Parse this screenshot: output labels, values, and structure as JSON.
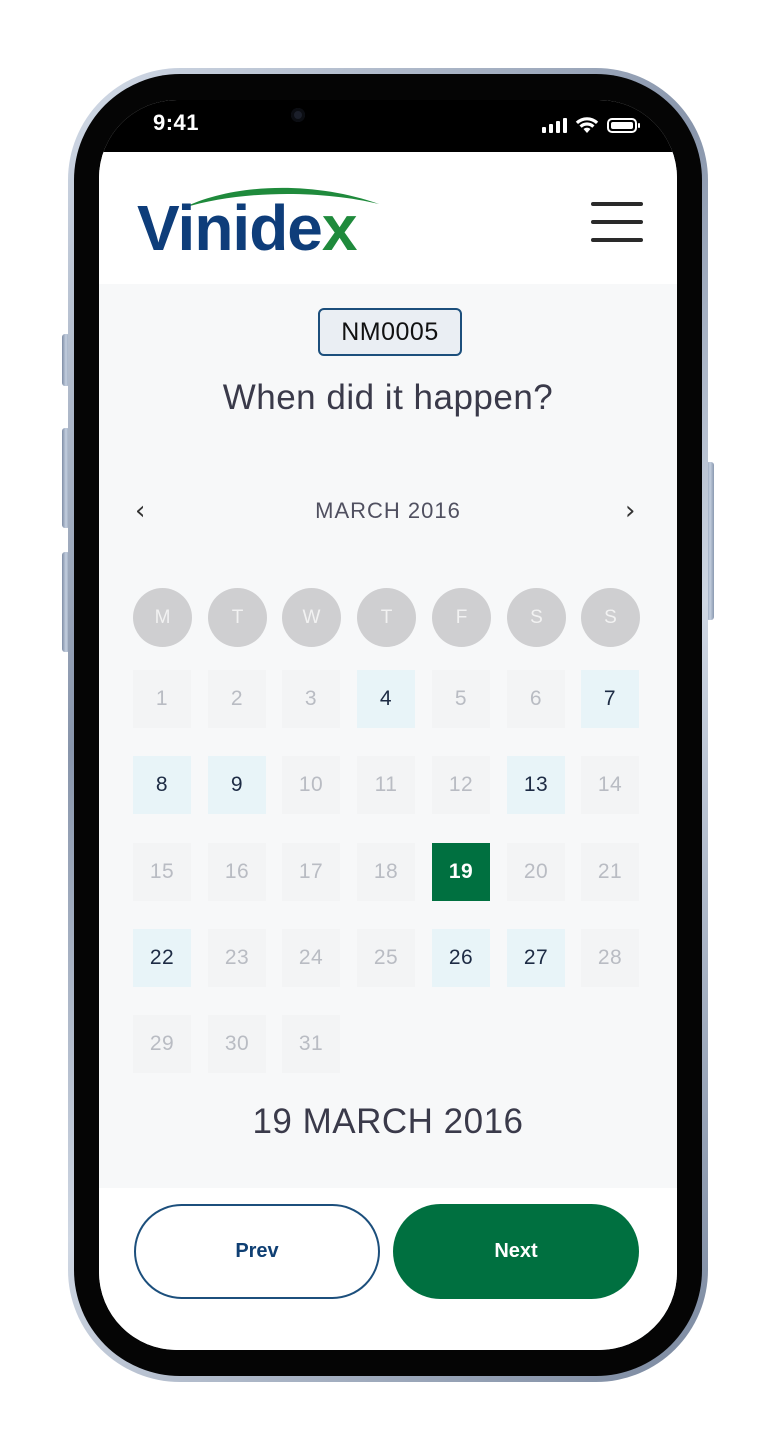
{
  "status_bar": {
    "time": "9:41",
    "icons": [
      "signal-icon",
      "wifi-icon",
      "battery-icon"
    ]
  },
  "header": {
    "logo_text_main": "Vinid",
    "logo_text_e": "e",
    "logo_text_x": "x",
    "brand_colors": {
      "blue": "#0e3d7a",
      "green": "#1f8a3c"
    },
    "menu_icon": "hamburger-icon"
  },
  "page": {
    "reference": "NM0005",
    "question": "When did it happen?"
  },
  "calendar": {
    "prev_arrow": "‹",
    "next_arrow": "›",
    "month": "MARCH 2016",
    "weekdays": [
      "M",
      "T",
      "W",
      "T",
      "F",
      "S",
      "S"
    ],
    "days": [
      {
        "label": "1",
        "state": "disabled"
      },
      {
        "label": "2",
        "state": "disabled"
      },
      {
        "label": "3",
        "state": "disabled"
      },
      {
        "label": "4",
        "state": "available"
      },
      {
        "label": "5",
        "state": "disabled"
      },
      {
        "label": "6",
        "state": "disabled"
      },
      {
        "label": "7",
        "state": "available"
      },
      {
        "label": "8",
        "state": "available"
      },
      {
        "label": "9",
        "state": "available"
      },
      {
        "label": "10",
        "state": "disabled"
      },
      {
        "label": "11",
        "state": "disabled"
      },
      {
        "label": "12",
        "state": "disabled"
      },
      {
        "label": "13",
        "state": "available"
      },
      {
        "label": "14",
        "state": "disabled"
      },
      {
        "label": "15",
        "state": "disabled"
      },
      {
        "label": "16",
        "state": "disabled"
      },
      {
        "label": "17",
        "state": "disabled"
      },
      {
        "label": "18",
        "state": "disabled"
      },
      {
        "label": "19",
        "state": "selected"
      },
      {
        "label": "20",
        "state": "disabled"
      },
      {
        "label": "21",
        "state": "disabled"
      },
      {
        "label": "22",
        "state": "available"
      },
      {
        "label": "23",
        "state": "disabled"
      },
      {
        "label": "24",
        "state": "disabled"
      },
      {
        "label": "25",
        "state": "disabled"
      },
      {
        "label": "26",
        "state": "available"
      },
      {
        "label": "27",
        "state": "available"
      },
      {
        "label": "28",
        "state": "disabled"
      },
      {
        "label": "29",
        "state": "disabled"
      },
      {
        "label": "30",
        "state": "disabled"
      },
      {
        "label": "31",
        "state": "disabled"
      }
    ],
    "selected_date": "19 MARCH 2016",
    "colors": {
      "selected": "#007040",
      "available": "#e8f4f8",
      "disabled": "#f3f4f5"
    }
  },
  "footer": {
    "prev_label": "Prev",
    "next_label": "Next"
  }
}
